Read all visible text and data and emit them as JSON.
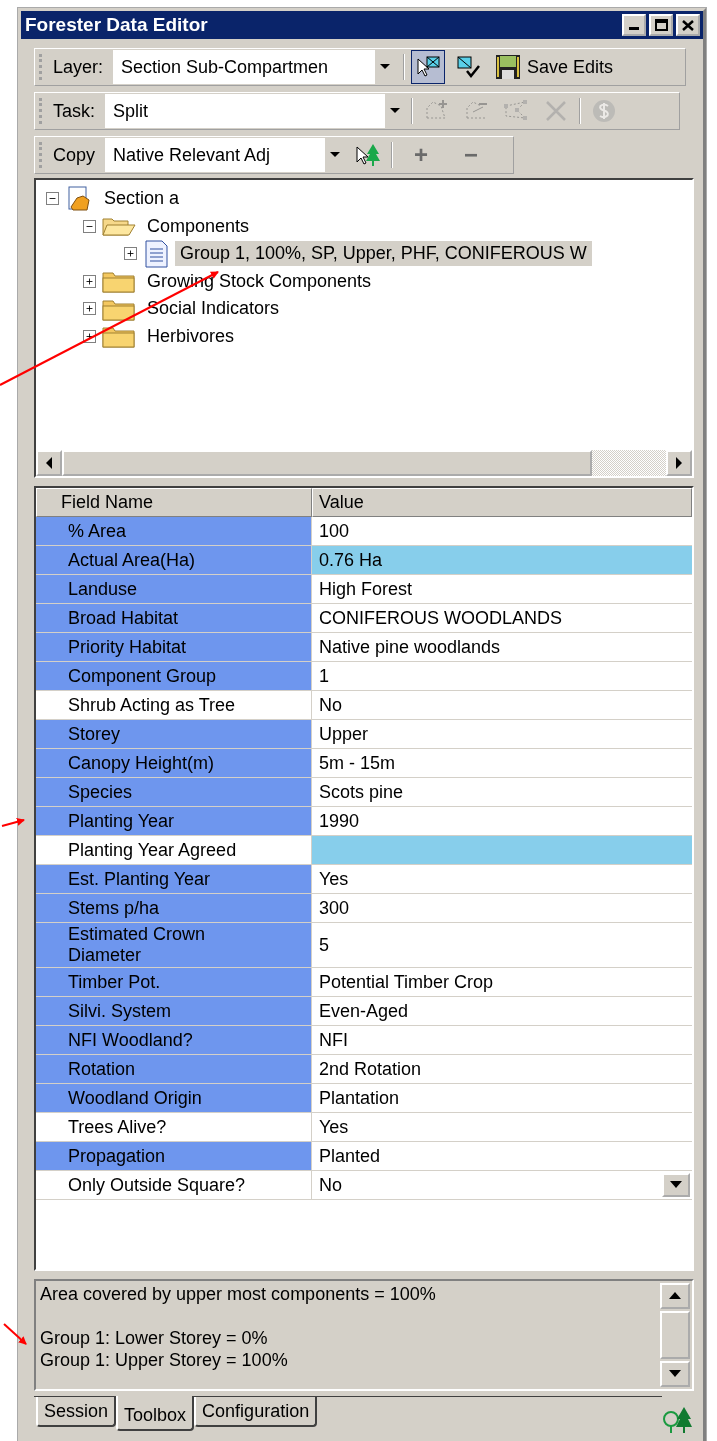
{
  "window": {
    "title": "Forester Data Editor"
  },
  "toolbars": [
    {
      "label": "Layer:",
      "combo": "Section Sub-Compartmen",
      "tools": [
        {
          "kind": "select",
          "selected": true,
          "disabled": false
        },
        {
          "kind": "validate",
          "selected": false,
          "disabled": false
        },
        {
          "kind": "save",
          "label": "Save Edits",
          "selected": false,
          "disabled": false
        }
      ]
    },
    {
      "label": "Task:",
      "combo": "Split",
      "tools": [
        {
          "kind": "separator"
        },
        {
          "kind": "add-polygon",
          "selected": false,
          "disabled": true
        },
        {
          "kind": "remove-polygon",
          "selected": false,
          "disabled": true
        },
        {
          "kind": "reshape",
          "selected": false,
          "disabled": true
        },
        {
          "kind": "delete",
          "selected": false,
          "disabled": true
        },
        {
          "kind": "separator"
        },
        {
          "kind": "s-circle",
          "selected": false,
          "disabled": true
        }
      ]
    },
    {
      "label": "Copy",
      "combo": "Native Relevant Adj",
      "tools": [
        {
          "kind": "pick-tree",
          "selected": false,
          "disabled": false
        },
        {
          "kind": "separator"
        },
        {
          "kind": "text",
          "label": "+",
          "selected": false,
          "disabled": true
        },
        {
          "kind": "text",
          "label": "−",
          "selected": false,
          "disabled": true
        }
      ]
    }
  ],
  "tree": [
    {
      "label": "Section a",
      "kind": "section",
      "expanded": true,
      "selected": false,
      "children": [
        {
          "label": "Components",
          "kind": "folder",
          "expanded": true,
          "selected": false,
          "children": [
            {
              "label": "Group 1, 100%, SP, Upper, PHF, CONIFEROUS W",
              "kind": "document",
              "expanded": false,
              "selected": true
            }
          ]
        },
        {
          "label": "Growing Stock Components",
          "kind": "folder",
          "expanded": false,
          "selected": false
        },
        {
          "label": "Social Indicators",
          "kind": "folder",
          "expanded": false,
          "selected": false
        },
        {
          "label": "Herbivores",
          "kind": "folder",
          "expanded": false,
          "selected": false
        }
      ]
    }
  ],
  "grid": {
    "columns": [
      "Field Name",
      "Value"
    ],
    "rows": [
      {
        "field": "% Area",
        "value": "100",
        "highlighted": true,
        "value_highlighted": false,
        "kind": "text"
      },
      {
        "field": "Actual Area(Ha)",
        "value": "0.76 Ha",
        "highlighted": true,
        "value_highlighted": true,
        "kind": "text"
      },
      {
        "field": "Landuse",
        "value": "High Forest",
        "highlighted": true,
        "value_highlighted": false,
        "kind": "text"
      },
      {
        "field": "Broad Habitat",
        "value": "CONIFEROUS WOODLANDS",
        "highlighted": true,
        "value_highlighted": false,
        "kind": "text"
      },
      {
        "field": "Priority Habitat",
        "value": "Native pine woodlands",
        "highlighted": true,
        "value_highlighted": false,
        "kind": "text"
      },
      {
        "field": "Component Group",
        "value": "1",
        "highlighted": true,
        "value_highlighted": false,
        "kind": "text"
      },
      {
        "field": "Shrub Acting as Tree",
        "value": "No",
        "highlighted": false,
        "value_highlighted": false,
        "kind": "text"
      },
      {
        "field": "Storey",
        "value": "Upper",
        "highlighted": true,
        "value_highlighted": false,
        "kind": "text"
      },
      {
        "field": "Canopy Height(m)",
        "value": "5m - 15m",
        "highlighted": true,
        "value_highlighted": false,
        "kind": "text"
      },
      {
        "field": "Species",
        "value": "Scots pine",
        "highlighted": true,
        "value_highlighted": false,
        "kind": "text"
      },
      {
        "field": "Planting Year",
        "value": "1990",
        "highlighted": true,
        "value_highlighted": false,
        "kind": "text"
      },
      {
        "field": "Planting Year Agreed",
        "highlighted": false,
        "value_highlighted": true,
        "kind": "text"
      },
      {
        "field": "Est. Planting Year",
        "value": "Yes",
        "highlighted": true,
        "value_highlighted": false,
        "kind": "text"
      },
      {
        "field": "Stems p/ha",
        "value": "300",
        "highlighted": true,
        "value_highlighted": false,
        "kind": "text"
      },
      {
        "field": "Estimated Crown Diameter",
        "value": "5",
        "highlighted": true,
        "value_highlighted": false,
        "kind": "text"
      },
      {
        "field": "Timber Pot.",
        "value": "Potential Timber Crop",
        "highlighted": true,
        "value_highlighted": false,
        "kind": "text"
      },
      {
        "field": "Silvi. System",
        "value": "Even-Aged",
        "highlighted": true,
        "value_highlighted": false,
        "kind": "text"
      },
      {
        "field": "NFI Woodland?",
        "value": "NFI",
        "highlighted": true,
        "value_highlighted": false,
        "kind": "text"
      },
      {
        "field": "Rotation",
        "value": "2nd Rotation",
        "highlighted": true,
        "value_highlighted": false,
        "kind": "text"
      },
      {
        "field": "Woodland Origin",
        "value": "Plantation",
        "highlighted": true,
        "value_highlighted": false,
        "kind": "text"
      },
      {
        "field": "Trees Alive?",
        "value": "Yes",
        "highlighted": false,
        "value_highlighted": false,
        "kind": "text"
      },
      {
        "field": "Propagation",
        "value": "Planted",
        "highlighted": true,
        "value_highlighted": false,
        "kind": "text"
      },
      {
        "field": "Only Outside Square?",
        "value": "No",
        "highlighted": false,
        "value_highlighted": false,
        "kind": "dropdown"
      }
    ]
  },
  "messages": [
    "Area covered by upper most components = 100%",
    "Group 1: Lower Storey = 0%",
    "Group 1: Upper Storey = 100%"
  ],
  "tabs": [
    {
      "label": "Session",
      "selected": false
    },
    {
      "label": "Toolbox",
      "selected": true
    },
    {
      "label": "Configuration",
      "selected": false
    }
  ]
}
